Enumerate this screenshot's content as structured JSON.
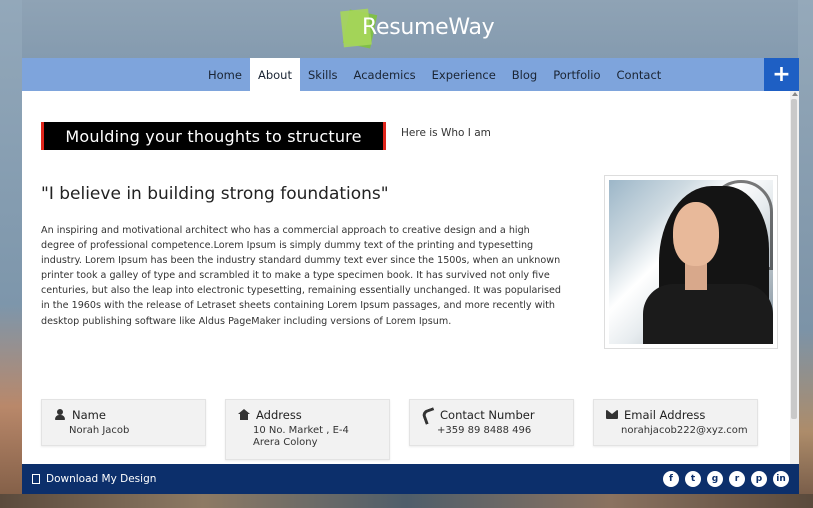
{
  "brand": {
    "name": "ResumeWay"
  },
  "nav": {
    "items": [
      "Home",
      "About",
      "Skills",
      "Academics",
      "Experience",
      "Blog",
      "Portfolio",
      "Contact"
    ],
    "active": "About",
    "plus_icon": "+"
  },
  "about": {
    "tagline": "Moulding your thoughts to structure",
    "who": "Here is Who I am",
    "quote": "\"I believe in building strong foundations\"",
    "bio": "An inspiring and motivational architect who has a commercial approach to creative design and a high degree of professional competence.Lorem Ipsum is simply dummy text of the printing and typesetting industry. Lorem Ipsum has been the industry standard dummy text ever since the 1500s, when an unknown printer took a galley of type and scrambled it to make a type specimen book. It has survived not only five centuries, but also the leap into electronic typesetting, remaining essentially unchanged. It was popularised in the 1960s with the release of Letraset sheets containing Lorem Ipsum passages, and more recently with desktop publishing software like Aldus PageMaker including versions of Lorem Ipsum."
  },
  "cards": [
    {
      "icon": "user-icon",
      "title": "Name",
      "value": "Norah Jacob"
    },
    {
      "icon": "home-icon",
      "title": "Address",
      "value": "10 No. Market , E-4 Arera Colony"
    },
    {
      "icon": "phone-icon",
      "title": "Contact Number",
      "value": "+359 89 8488 496"
    },
    {
      "icon": "mail-icon",
      "title": "Email Address",
      "value": "norahjacob222@xyz.com"
    }
  ],
  "footer": {
    "download_label": "Download My Design",
    "social": [
      {
        "icon": "facebook-icon",
        "glyph": "f"
      },
      {
        "icon": "twitter-icon",
        "glyph": "t"
      },
      {
        "icon": "google-plus-icon",
        "glyph": "g"
      },
      {
        "icon": "rss-icon",
        "glyph": "r"
      },
      {
        "icon": "pinterest-icon",
        "glyph": "p"
      },
      {
        "icon": "linkedin-icon",
        "glyph": "in"
      }
    ]
  },
  "colors": {
    "nav_bg": "#7ea4dc",
    "plus_bg": "#1e5fc4",
    "footer_bg": "#0c2f6b",
    "tagline_accent": "#e0251b"
  }
}
